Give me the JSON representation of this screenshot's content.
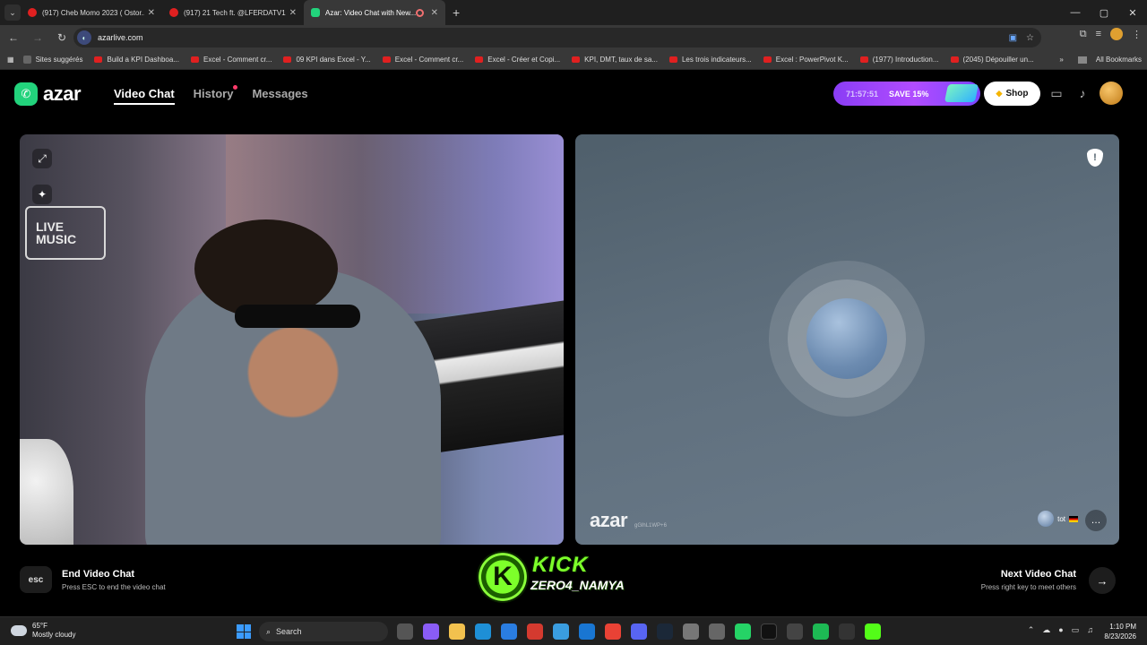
{
  "browser": {
    "tabs": [
      {
        "title": "(917) Cheb Momo 2023 ( Ostor...",
        "active": false
      },
      {
        "title": "(917) 21 Tech ft. @LFERDATV12...",
        "active": false
      },
      {
        "title": "Azar: Video Chat with New...",
        "active": true
      }
    ],
    "url": "azarlive.com",
    "bookmarks": [
      "Sites suggérés",
      "Build a KPI Dashboa...",
      "Excel - Comment cr...",
      "09 KPI dans Excel - Y...",
      "Excel - Comment cr...",
      "Excel - Créer et Copi...",
      "KPI, DMT, taux de sa...",
      "Les trois indicateurs...",
      "Excel : PowerPivot K...",
      "(1977) Introduction...",
      "(2045) Dépouiller un..."
    ],
    "all_bookmarks": "All Bookmarks"
  },
  "azar": {
    "logo": "azar",
    "nav": {
      "video_chat": "Video Chat",
      "history": "History",
      "messages": "Messages"
    },
    "promo": {
      "timer": "71:57:51",
      "save": "SAVE 15%"
    },
    "shop": "Shop",
    "left_video": {
      "sign_line1": "LIVE",
      "sign_line2": "MUSIC"
    },
    "right_video": {
      "watermark": "azar",
      "watermark_id": "gGlhL1WP+6",
      "partner_name": "tot"
    },
    "end": {
      "key": "esc",
      "title": "End Video Chat",
      "subtitle": "Press ESC to end the video chat"
    },
    "next": {
      "title": "Next Video Chat",
      "subtitle": "Press right key to meet others"
    },
    "kick": {
      "line1": "KICK",
      "line2": "ZERO4_NAMYA"
    }
  },
  "taskbar": {
    "weather_temp": "65°F",
    "weather_desc": "Mostly cloudy",
    "search": "Search",
    "time": "1:10 PM",
    "date": "8/23/2026"
  },
  "colors": {
    "azar_green": "#22d37c",
    "promo_purple": "#a34cff",
    "kick_green": "#7dff2a"
  }
}
